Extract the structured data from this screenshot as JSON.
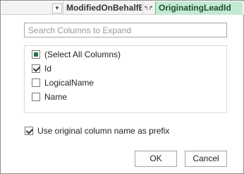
{
  "header": {
    "column1": "ModifiedOnBehalfBy",
    "column2": "OriginatingLeadId",
    "arrow_glyph": "▼",
    "expand_glyph": "↰↱"
  },
  "search": {
    "placeholder": "Search Columns to Expand",
    "value": ""
  },
  "columns": {
    "select_all": {
      "label": "(Select All Columns)",
      "state": "partial"
    },
    "items": [
      {
        "label": "Id",
        "checked": true
      },
      {
        "label": "LogicalName",
        "checked": false
      },
      {
        "label": "Name",
        "checked": false
      }
    ]
  },
  "prefix_option": {
    "label": "Use original column name as prefix",
    "checked": true
  },
  "buttons": {
    "ok": "OK",
    "cancel": "Cancel"
  },
  "colors": {
    "accent": "#217346",
    "selected_header": "#c2ead2"
  }
}
